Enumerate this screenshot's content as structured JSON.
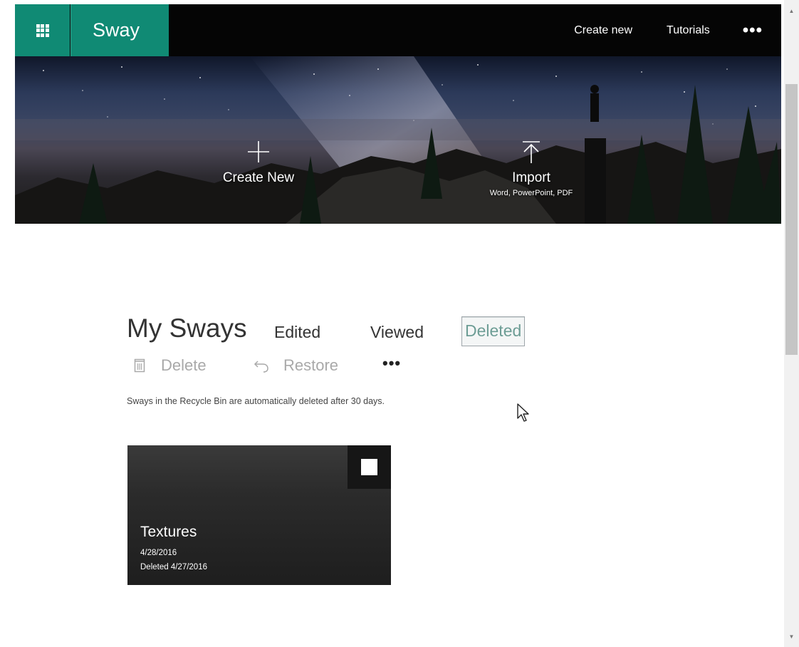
{
  "header": {
    "app_name": "Sway",
    "app_launcher_icon": "waffle-icon",
    "links": [
      {
        "label": "Create new"
      },
      {
        "label": "Tutorials"
      }
    ],
    "more_label": "•••",
    "brand_color": "#108a74"
  },
  "hero": {
    "create": {
      "label": "Create New",
      "icon": "plus-icon"
    },
    "import": {
      "label": "Import",
      "sublabel": "Word, PowerPoint, PDF",
      "icon": "upload-icon"
    }
  },
  "main": {
    "title": "My Sways",
    "tabs": [
      {
        "label": "Edited",
        "selected": false
      },
      {
        "label": "Viewed",
        "selected": false
      },
      {
        "label": "Deleted",
        "selected": true
      }
    ],
    "commands": {
      "delete": {
        "label": "Delete",
        "icon": "trash-icon",
        "enabled": false
      },
      "restore": {
        "label": "Restore",
        "icon": "undo-icon",
        "enabled": false
      },
      "more_label": "•••"
    },
    "notice": "Sways in the Recycle Bin are automatically deleted after 30 days.",
    "cards": [
      {
        "title": "Textures",
        "date": "4/28/2016",
        "deleted": "Deleted 4/27/2016",
        "checked": false
      }
    ]
  }
}
